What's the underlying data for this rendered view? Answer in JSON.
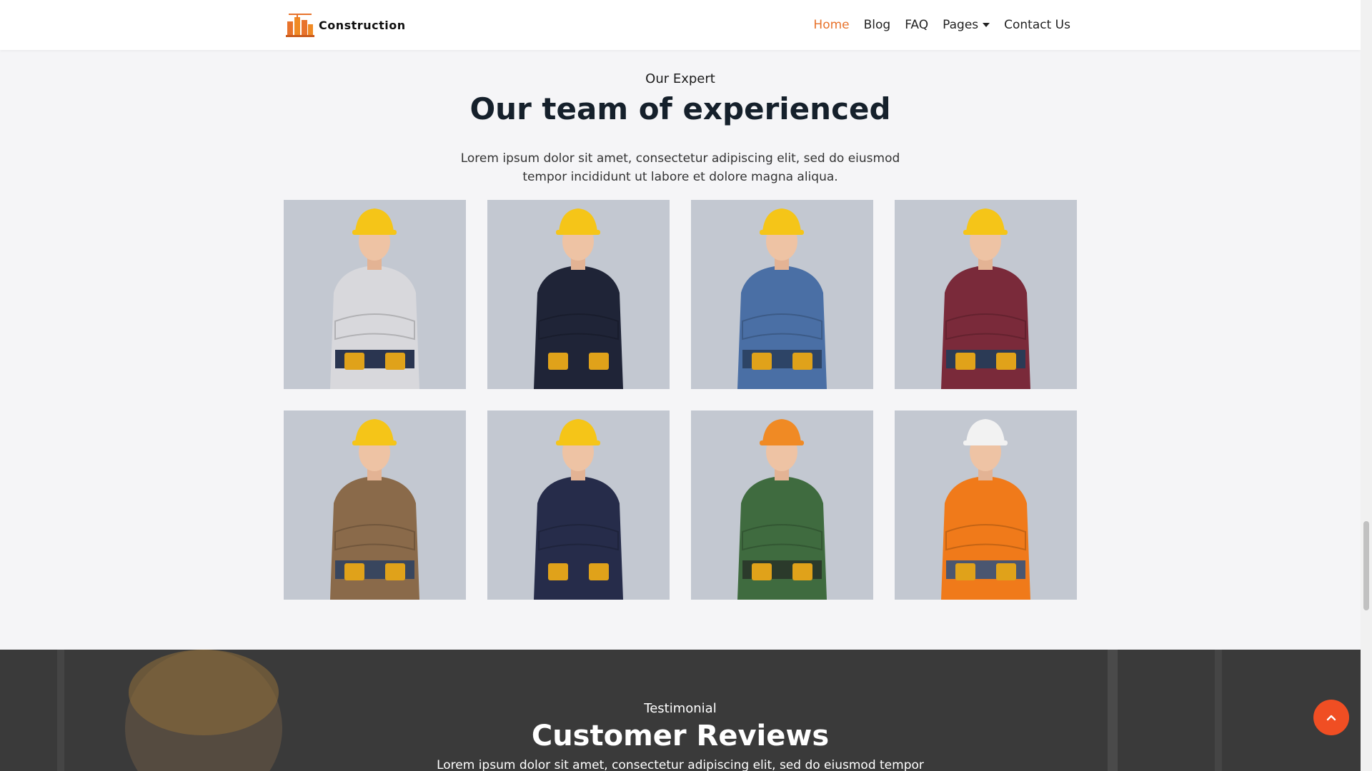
{
  "brand": {
    "name": "Construction",
    "logo_icon": "building-crane-icon",
    "accent": "#e8732c"
  },
  "nav": {
    "items": [
      {
        "label": "Home",
        "active": true
      },
      {
        "label": "Blog",
        "active": false
      },
      {
        "label": "FAQ",
        "active": false
      },
      {
        "label": "Pages",
        "active": false,
        "dropdown": true
      },
      {
        "label": "Contact Us",
        "active": false
      }
    ]
  },
  "team": {
    "eyebrow": "Our Expert",
    "title": "Our team of experienced",
    "description": "Lorem ipsum dolor sit amet, consectetur adipiscing elit, sed do eiusmod tempor incididunt ut labore et dolore magna aliqua.",
    "members": [
      {
        "helmet": "#f5c518",
        "top": "#d8d8dc",
        "pants": "#2a3550"
      },
      {
        "helmet": "#f5c518",
        "top": "#1f2437",
        "pants": "#1f2437"
      },
      {
        "helmet": "#f5c518",
        "top": "#4a6fa5",
        "pants": "#2d4466"
      },
      {
        "helmet": "#f5c518",
        "top": "#7a2a3a",
        "pants": "#2b3a55"
      },
      {
        "helmet": "#f5c518",
        "top": "#8a6a4a",
        "pants": "#39465e"
      },
      {
        "helmet": "#f5c518",
        "top": "#262c4a",
        "pants": "#262c4a"
      },
      {
        "helmet": "#f08a24",
        "top": "#3f6b3f",
        "pants": "#2b3a2b"
      },
      {
        "helmet": "#f2f2f2",
        "top": "#f07a1a",
        "pants": "#4a5670"
      }
    ]
  },
  "testimonial": {
    "eyebrow": "Testimonial",
    "title": "Customer Reviews",
    "description": "Lorem ipsum dolor sit amet, consectetur adipiscing elit, sed do eiusmod tempor"
  },
  "back_to_top": {
    "icon": "chevron-up-icon",
    "color": "#f04e23"
  }
}
